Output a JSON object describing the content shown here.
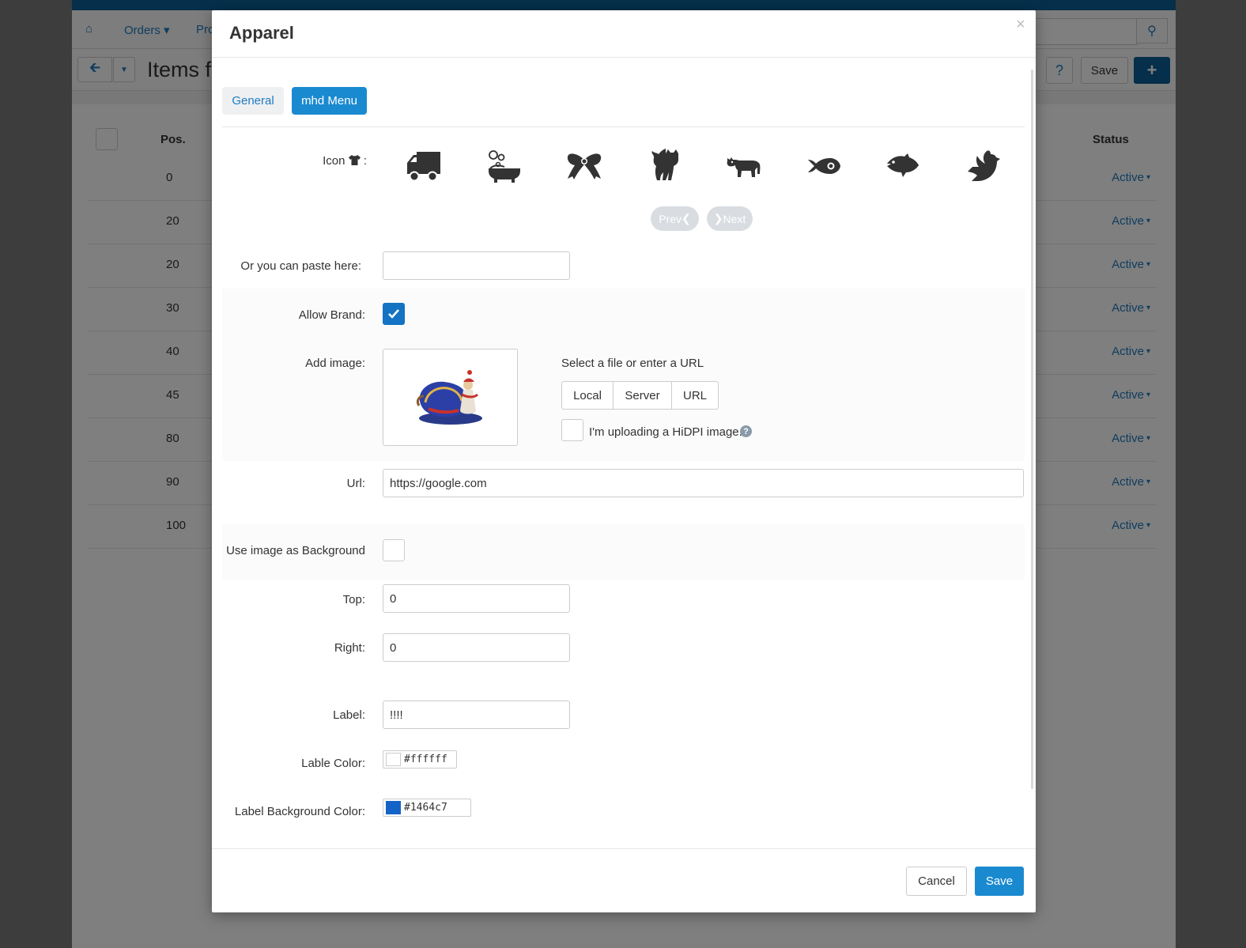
{
  "background": {
    "menu": [
      "Orders",
      "Pro"
    ],
    "page_title": "Items f",
    "toolbar_save": "Save",
    "table": {
      "headers": {
        "pos": "Pos.",
        "status": "Status"
      },
      "rows": [
        {
          "pos": "0",
          "status": "Active"
        },
        {
          "pos": "20",
          "status": "Active"
        },
        {
          "pos": "20",
          "status": "Active"
        },
        {
          "pos": "30",
          "status": "Active"
        },
        {
          "pos": "40",
          "status": "Active"
        },
        {
          "pos": "45",
          "status": "Active"
        },
        {
          "pos": "80",
          "status": "Active"
        },
        {
          "pos": "90",
          "status": "Active"
        },
        {
          "pos": "100",
          "status": "Active"
        }
      ]
    }
  },
  "modal": {
    "title": "Apparel",
    "close": "×",
    "tabs": [
      "General",
      "mhd Menu"
    ],
    "active_tab": "mhd Menu",
    "icon_label": "Icon",
    "icon_suffix": ":",
    "icons": [
      "truck-icon",
      "bath-icon",
      "ribbon-icon",
      "cat-icon",
      "cow-icon",
      "fish-eye-icon",
      "fish-icon",
      "dove-icon"
    ],
    "prev": "Prev",
    "next": "Next",
    "paste_label": "Or you can paste here:",
    "paste_value": "",
    "allow_brand_label": "Allow Brand:",
    "allow_brand_checked": true,
    "add_image_label": "Add image:",
    "select_file_text": "Select a file or enter a URL",
    "source_buttons": [
      "Local",
      "Server",
      "URL"
    ],
    "hidpi_label": "I'm uploading a HiDPI image.",
    "url_label": "Url:",
    "url_value": "https://google.com",
    "use_bg_label": "Use image as Background",
    "use_bg_checked": false,
    "top_label": "Top:",
    "top_value": "0",
    "right_label": "Right:",
    "right_value": "0",
    "label_label": "Label:",
    "label_value": "!!!!",
    "label_color_label": "Lable Color:",
    "label_color_value": "#ffffff",
    "label_bg_color_label": "Label Background Color:",
    "label_bg_color_value": "#1464c7",
    "cancel": "Cancel",
    "save": "Save"
  },
  "colors": {
    "accent": "#1a8ad0",
    "topbar": "#0b5f96",
    "link": "#1e7bbf"
  }
}
